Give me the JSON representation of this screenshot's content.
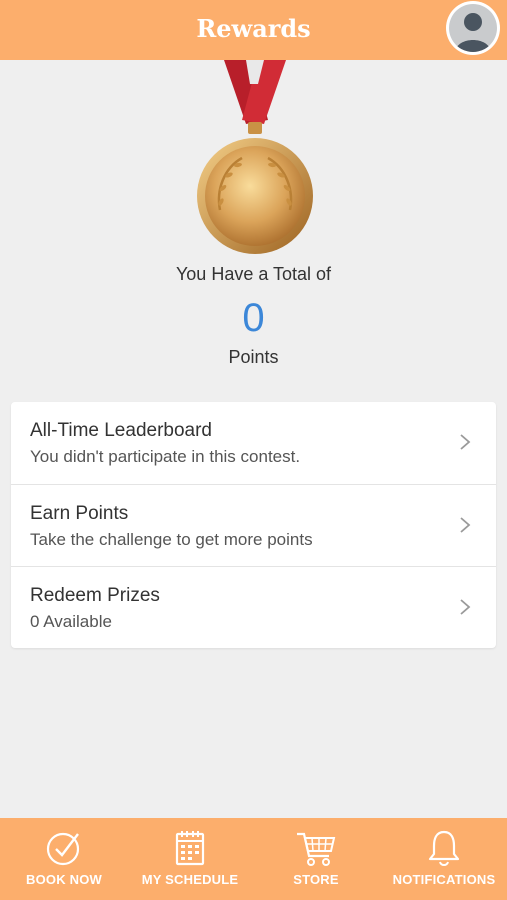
{
  "header": {
    "title": "Rewards"
  },
  "summary": {
    "total_label": "You Have a Total of",
    "points_value": "0",
    "points_label": "Points"
  },
  "menu": {
    "items": [
      {
        "title": "All-Time Leaderboard",
        "subtitle": "You didn't participate in this contest."
      },
      {
        "title": "Earn Points",
        "subtitle": "Take the challenge to get more points"
      },
      {
        "title": "Redeem Prizes",
        "subtitle": "0 Available"
      }
    ]
  },
  "bottom_nav": {
    "items": [
      {
        "label": "BOOK NOW",
        "icon": "check-circle-icon"
      },
      {
        "label": "MY SCHEDULE",
        "icon": "calendar-icon"
      },
      {
        "label": "STORE",
        "icon": "cart-icon"
      },
      {
        "label": "NOTIFICATIONS",
        "icon": "bell-icon"
      }
    ]
  },
  "colors": {
    "header": "#fcae6c",
    "accent_points": "#3c87d8",
    "background": "#efefef"
  }
}
